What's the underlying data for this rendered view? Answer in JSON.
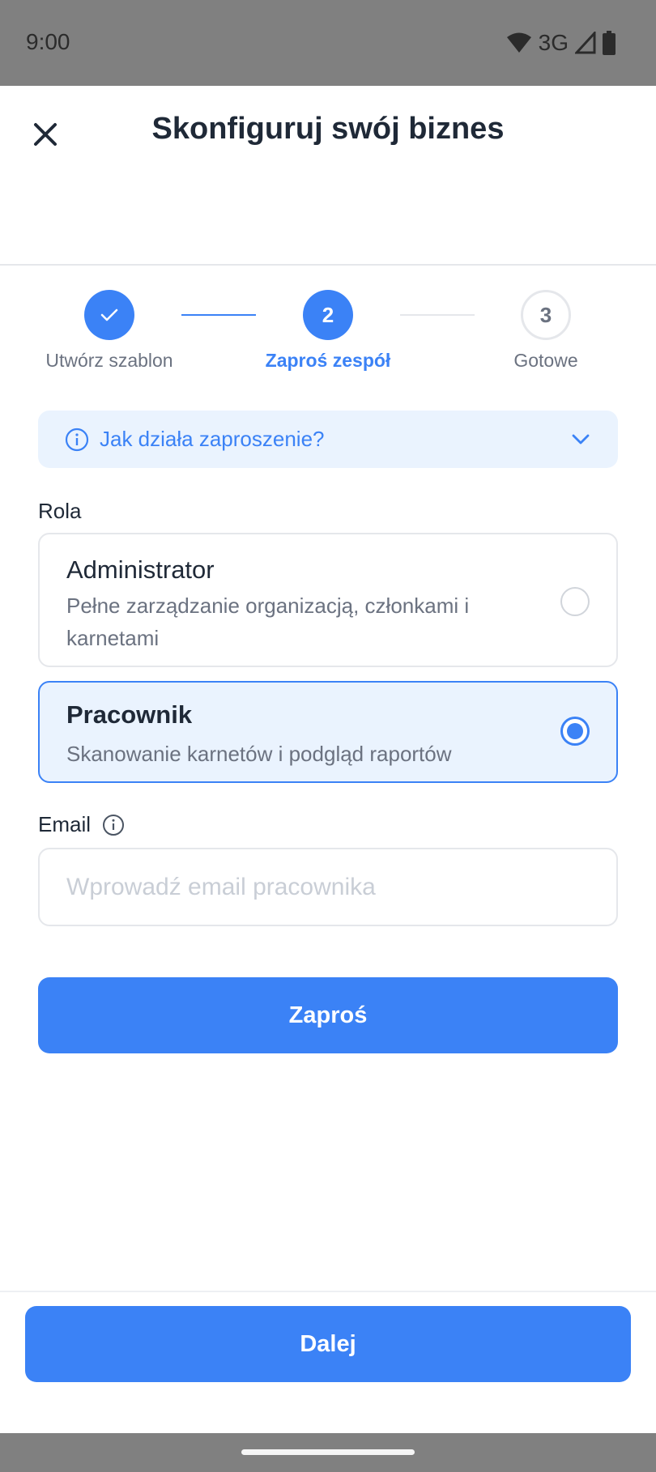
{
  "status_bar": {
    "time": "9:00",
    "network": "3G"
  },
  "header": {
    "title": "Skonfiguruj swój biznes",
    "close_icon": "close-icon"
  },
  "stepper": {
    "steps": [
      {
        "label": "Utwórz szablon",
        "number": "1",
        "state": "completed"
      },
      {
        "label": "Zaproś zespół",
        "number": "2",
        "state": "active"
      },
      {
        "label": "Gotowe",
        "number": "3",
        "state": "todo"
      }
    ]
  },
  "info": {
    "text": "Jak działa zaproszenie?",
    "icon": "info-icon",
    "expand_icon": "chevron-down-icon"
  },
  "role": {
    "label": "Rola",
    "options": [
      {
        "title": "Administrator",
        "description": "Pełne zarządzanie organizacją, członkami i karnetami",
        "selected": false
      },
      {
        "title": "Pracownik",
        "description": "Skanowanie karnetów i podgląd raportów",
        "selected": true
      }
    ]
  },
  "email": {
    "label": "Email",
    "placeholder": "Wprowadź email pracownika",
    "value": ""
  },
  "invite_button": {
    "label": "Zaproś"
  },
  "next_button": {
    "label": "Dalej"
  },
  "colors": {
    "accent": "#3b82f6",
    "accent_light": "#eaf3fe",
    "text": "#1f2937",
    "muted": "#6b7280"
  }
}
